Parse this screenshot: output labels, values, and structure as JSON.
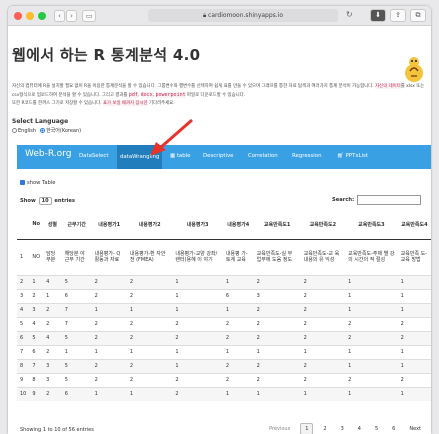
{
  "browser": {
    "url": "cardiomoon.shinyapps.io",
    "colors": {
      "close": "#fc5f57",
      "min": "#fdbc2e",
      "max": "#28c840"
    }
  },
  "page": {
    "title": "웹에서 하는 R 통계분석 4.0",
    "intro_a": "자신의 컴퓨터에 R을 설치할 필요 없이 R을 이용한 통계분석을 할 수 있습니다. 그룹변수와 행변수를 선택하여 쉽게 표를 만들 수 있으며 그래프를 통한 자료 탐색과 여러가지 통계",
    "intro_b": "분석이 가능합니다.",
    "intro_hl": "자신의 데이터",
    "intro_c": "를 xlsx 또는 csv형식으로 업로드하여 분석을 할 수 있습니다. 그리고 결과를",
    "code1": "pdf",
    "code2": "docx",
    "code3": "powerpoint",
    "intro_d": "파일로 다운로드할 수 있습니다.",
    "intro_e": "또한 R코드를 한꺼스 그기로 저장할 수 있습니다.",
    "intro_hl2": "표가 보일 때까지 잠시만",
    "intro_f": "기다려주세요."
  },
  "language": {
    "label": "Select Language",
    "options": [
      "English",
      "한국어(Korean)"
    ],
    "selected": "한국어(Korean)"
  },
  "nav": {
    "brand": "Web-R.org",
    "items": [
      "DataSelect",
      "dataWrangling",
      "table",
      "Descriptive",
      "Correlation",
      "Regression",
      "PPTxList"
    ],
    "active": "dataWrangling",
    "color": "#3aa0e4",
    "active_color": "#217dbb"
  },
  "table": {
    "show_table": "show Table",
    "show_label": "Show",
    "entries_value": "10",
    "entries_label": "entries",
    "search_label": "Search:",
    "headers": [
      "",
      "No",
      "성별",
      "근무기간",
      "내용평가1",
      "내용평가2",
      "내용평가3",
      "내용평가4",
      "교육만족도1",
      "교육만족도2",
      "교육만족도3",
      "교육만족도4"
    ],
    "first_row": [
      "1",
      "NO",
      "담당 부분",
      "해당분 야 근무 기간",
      "내용평가- Q활동과 자료",
      "내용평가-환 자안전 (FMEA)",
      "내용평가-교양 강좌/렌터(용혜 이 야기",
      "내용평 가-토계 교육",
      "교육만족도-실 무 업무에 도움 정도",
      "교육만족도-교 육 내용의 유 익성",
      "교육만족도-주제 별 강의 시간의 적 절성",
      "교육만족 도-교육 방법"
    ],
    "rows": [
      [
        "2",
        "1",
        "4",
        "5",
        "2",
        "2",
        "1",
        "1",
        "2",
        "2",
        "1",
        "1"
      ],
      [
        "3",
        "2",
        "1",
        "6",
        "2",
        "2",
        "1",
        "6",
        "3",
        "2",
        "1",
        "1"
      ],
      [
        "4",
        "3",
        "2",
        "7",
        "1",
        "1",
        "1",
        "1",
        "2",
        "2",
        "1",
        "1"
      ],
      [
        "5",
        "4",
        "2",
        "7",
        "2",
        "2",
        "2",
        "2",
        "2",
        "2",
        "2",
        "2"
      ],
      [
        "6",
        "5",
        "4",
        "5",
        "2",
        "2",
        "2",
        "2",
        "2",
        "2",
        "2",
        "2"
      ],
      [
        "7",
        "6",
        "2",
        "1",
        "1",
        "1",
        "1",
        "1",
        "1",
        "1",
        "1",
        "1"
      ],
      [
        "8",
        "7",
        "3",
        "5",
        "2",
        "2",
        "1",
        "2",
        "2",
        "2",
        "1",
        "1"
      ],
      [
        "9",
        "8",
        "3",
        "5",
        "2",
        "2",
        "2",
        "2",
        "2",
        "2",
        "2",
        "2"
      ],
      [
        "10",
        "9",
        "2",
        "6",
        "1",
        "1",
        "2",
        "1",
        "1",
        "1",
        "1",
        "1"
      ]
    ],
    "info": "Showing 1 to 10 of 56 entries",
    "prev": "Previous",
    "pages": [
      "1",
      "2",
      "3",
      "4",
      "5",
      "6"
    ],
    "current": "1",
    "next": "Next"
  }
}
